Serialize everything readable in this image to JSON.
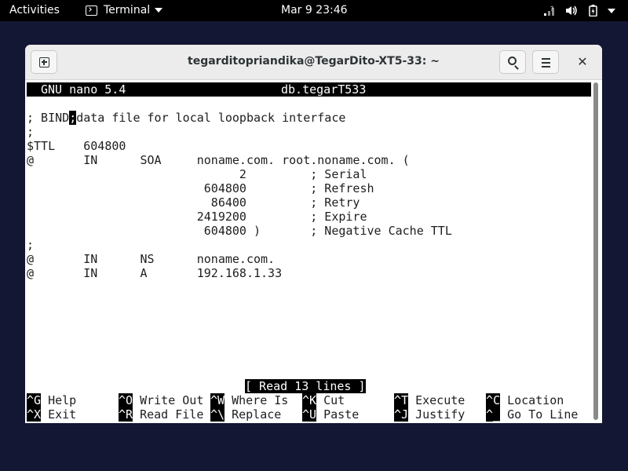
{
  "topbar": {
    "activities": "Activities",
    "app_name": "Terminal",
    "clock": "Mar 9  23:46",
    "icons": [
      "network-icon",
      "volume-icon",
      "battery-icon",
      "system-menu-caret"
    ]
  },
  "window": {
    "title": "tegarditopriandika@TegarDito-XT5-33: ~",
    "buttons": [
      "new-tab-icon",
      "search-icon",
      "hamburger-menu-icon",
      "close-icon"
    ]
  },
  "nano": {
    "version": "GNU nano 5.4",
    "filename": "db.tegarT533",
    "cursor_char": ";",
    "lines": [
      "; BIND data file for local loopback interface",
      ";",
      "$TTL    604800",
      "@       IN      SOA     noname.com. root.noname.com. (",
      "                              2         ; Serial",
      "                         604800         ; Refresh",
      "                          86400         ; Retry",
      "                        2419200         ; Expire",
      "                         604800 )       ; Negative Cache TTL",
      ";",
      "@       IN      NS      noname.com.",
      "@       IN      A       192.168.1.33"
    ],
    "status": "[ Read 13 lines ]",
    "shortcuts": [
      [
        {
          "key": "^G",
          "label": " Help"
        },
        {
          "key": "^O",
          "label": " Write Out"
        },
        {
          "key": "^W",
          "label": " Where Is"
        },
        {
          "key": "^K",
          "label": " Cut"
        },
        {
          "key": "^T",
          "label": " Execute"
        },
        {
          "key": "^C",
          "label": " Location"
        }
      ],
      [
        {
          "key": "^X",
          "label": " Exit"
        },
        {
          "key": "^R",
          "label": " Read File"
        },
        {
          "key": "^\\",
          "label": " Replace"
        },
        {
          "key": "^U",
          "label": " Paste"
        },
        {
          "key": "^J",
          "label": " Justify"
        },
        {
          "key": "^_",
          "label": " Go To Line"
        }
      ]
    ]
  }
}
